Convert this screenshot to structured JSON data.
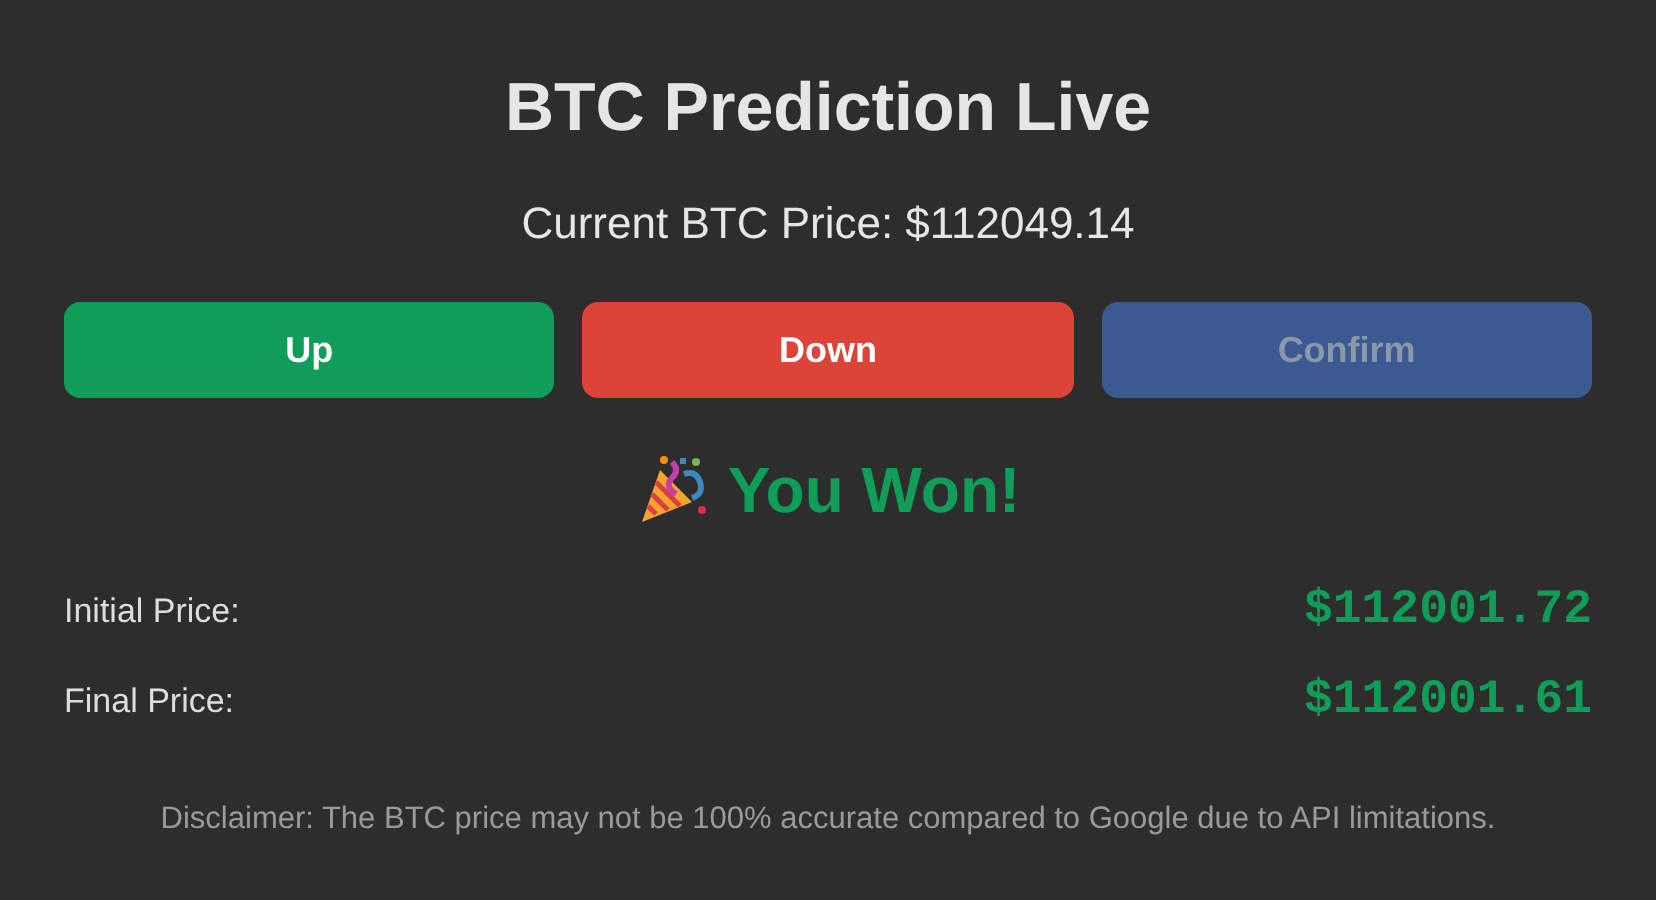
{
  "title": "BTC Prediction Live",
  "current_price": "Current BTC Price: $112049.14",
  "buttons": [
    {
      "label": "Up",
      "kind": "up",
      "disabled": false
    },
    {
      "label": "Down",
      "kind": "down",
      "disabled": false
    },
    {
      "label": "Confirm",
      "kind": "confirm",
      "disabled": true
    }
  ],
  "result": {
    "text": "You Won!",
    "kind": "won"
  },
  "prices": [
    {
      "label": "Initial Price:",
      "value": "$112001.72"
    },
    {
      "label": "Final Price:",
      "value": "$112001.61"
    }
  ],
  "disclaimer": "Disclaimer: The BTC price may not be 100% accurate compared to Google due to API limitations."
}
